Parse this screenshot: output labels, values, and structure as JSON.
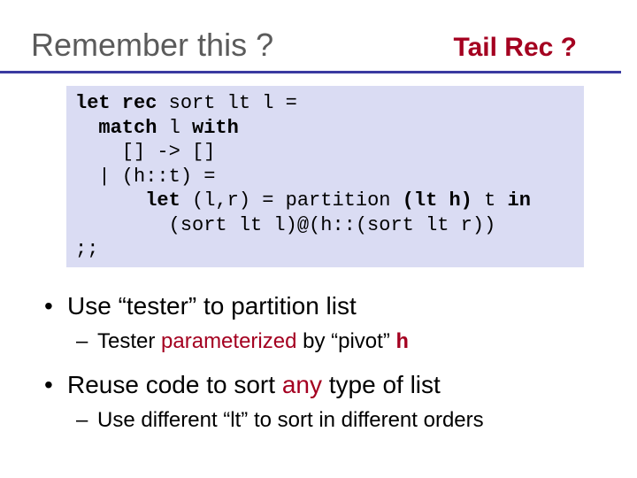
{
  "title_left": "Remember this ?",
  "title_right": "Tail Rec  ?",
  "code": {
    "l1a": "let rec ",
    "l1b": "sort lt l = ",
    "l2a": "  match ",
    "l2b": "l ",
    "l2c": "with",
    "l3": "    [] -> []",
    "l4": "  | (h::t) = ",
    "l5a": "      let ",
    "l5b": "(l,r) = partition ",
    "l5c": "(lt h)",
    "l5d": " t ",
    "l5e": "in",
    "l6": "        (sort lt l)@(h::(sort lt r))",
    "l7": ";;"
  },
  "bullets": {
    "b1a": "Use “tester” to partition list",
    "b1a_s1": "Tester ",
    "b1a_s2": "parameterized",
    "b1a_s3": " by “pivot” ",
    "b1a_s4": "h",
    "b1b_1": "Reuse code to sort ",
    "b1b_2": "any",
    "b1b_3": " type of list",
    "b1b_s1": "Use different “lt” to sort in different orders"
  }
}
